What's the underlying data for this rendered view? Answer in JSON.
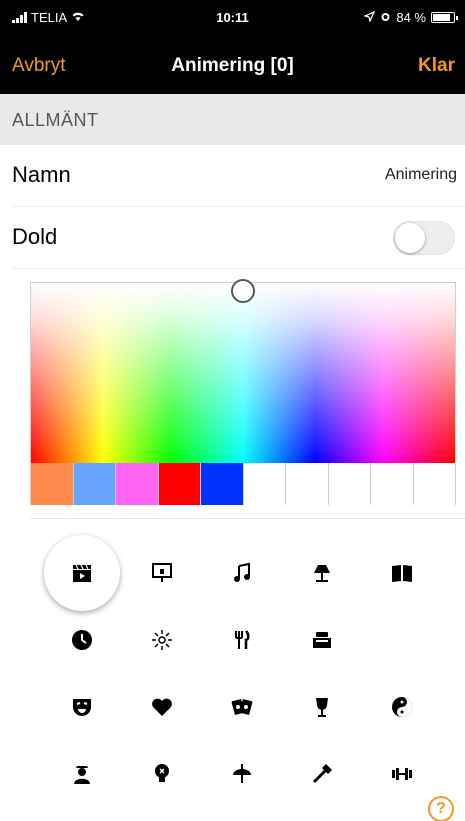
{
  "status": {
    "carrier": "TELIA",
    "time": "10:11",
    "battery": "84 %",
    "battery_level": 0.84
  },
  "nav": {
    "cancel": "Avbryt",
    "title": "Animering [0]",
    "done": "Klar"
  },
  "section": {
    "header": "ALLMÄNT"
  },
  "rows": {
    "name_label": "Namn",
    "name_value": "Animering",
    "hidden_label": "Dold",
    "hidden_on": false
  },
  "colors": {
    "accent": "#f39a1e",
    "swatches": [
      "#ff8a4c",
      "#66a3ff",
      "#ff66f2",
      "#ff0000",
      "#0033ff",
      "#ffffff",
      "#ffffff",
      "#ffffff",
      "#ffffff",
      "#ffffff"
    ]
  },
  "icons": [
    [
      "film-clapper-icon",
      "projector-screen-icon",
      "music-note-icon",
      "table-lamp-icon",
      "book-icon"
    ],
    [
      "clock-icon",
      "sun-icon",
      "fork-knife-icon",
      "bed-icon",
      "moon-icon"
    ],
    [
      "theater-mask-icon",
      "heart-icon",
      "playing-cards-icon",
      "wine-glass-icon",
      "yin-yang-icon"
    ],
    [
      "person-icon",
      "light-bulb-icon",
      "ceiling-lamp-icon",
      "hammer-icon",
      "dumbbell-icon"
    ]
  ],
  "help": {
    "label": "?"
  }
}
